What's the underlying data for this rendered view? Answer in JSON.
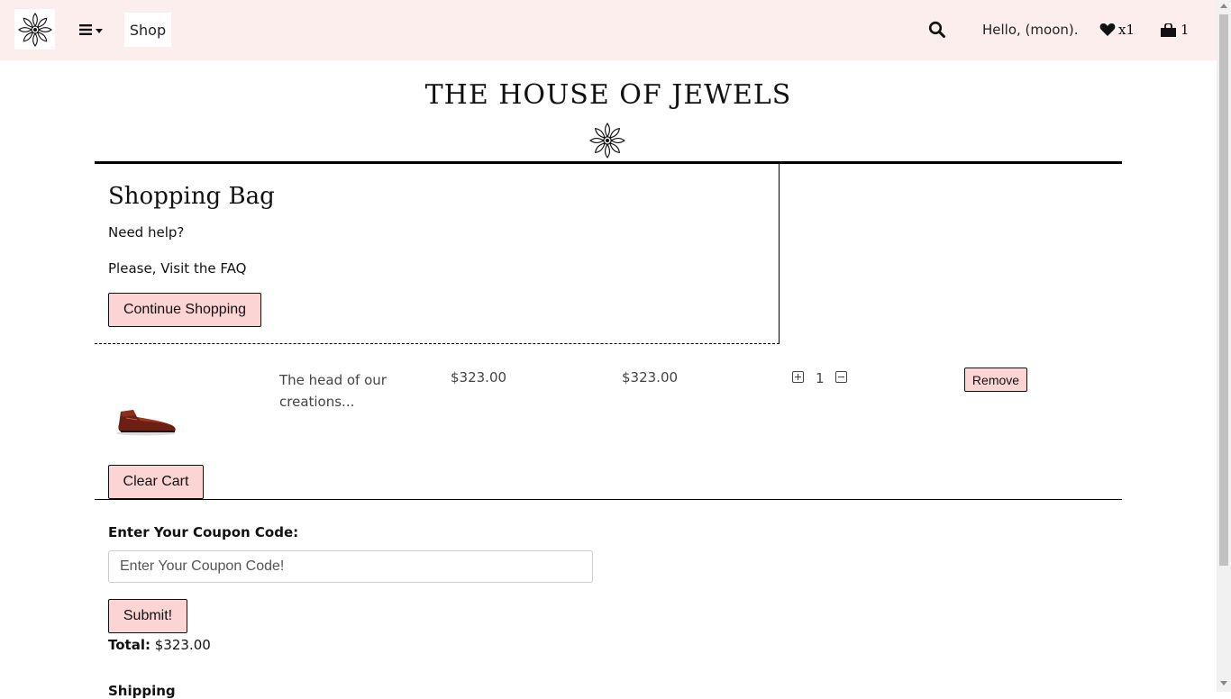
{
  "nav": {
    "shop_label": "Shop",
    "greeting": "Hello, (moon).",
    "wishlist_count": "x1",
    "bag_count": "1"
  },
  "header": {
    "site_title": "THE HOUSE OF JEWELS"
  },
  "bag": {
    "title": "Shopping Bag",
    "help_text": "Need help?",
    "faq_text": "Please, Visit the FAQ",
    "continue_label": "Continue Shopping"
  },
  "cart": {
    "items": [
      {
        "description": "The head of our creations...",
        "price": "$323.00",
        "subtotal": "$323.00",
        "quantity": "1",
        "remove_label": "Remove",
        "image": "brown-leather-boot"
      }
    ],
    "clear_label": "Clear Cart"
  },
  "coupon": {
    "label": "Enter Your Coupon Code:",
    "placeholder": "Enter Your Coupon Code!",
    "submit_label": "Submit!"
  },
  "totals": {
    "total_label": "Total:",
    "total_value": "$323.00",
    "shipping_label": "Shipping"
  },
  "icons": {
    "logo": "flower-mandala-icon",
    "menu": "hamburger-icon",
    "search": "search-icon",
    "wishlist": "heart-icon",
    "bag": "shopping-bag-icon"
  },
  "colors": {
    "navbar_bg": "#fdeeee",
    "button_bg": "#fdd4d4"
  }
}
